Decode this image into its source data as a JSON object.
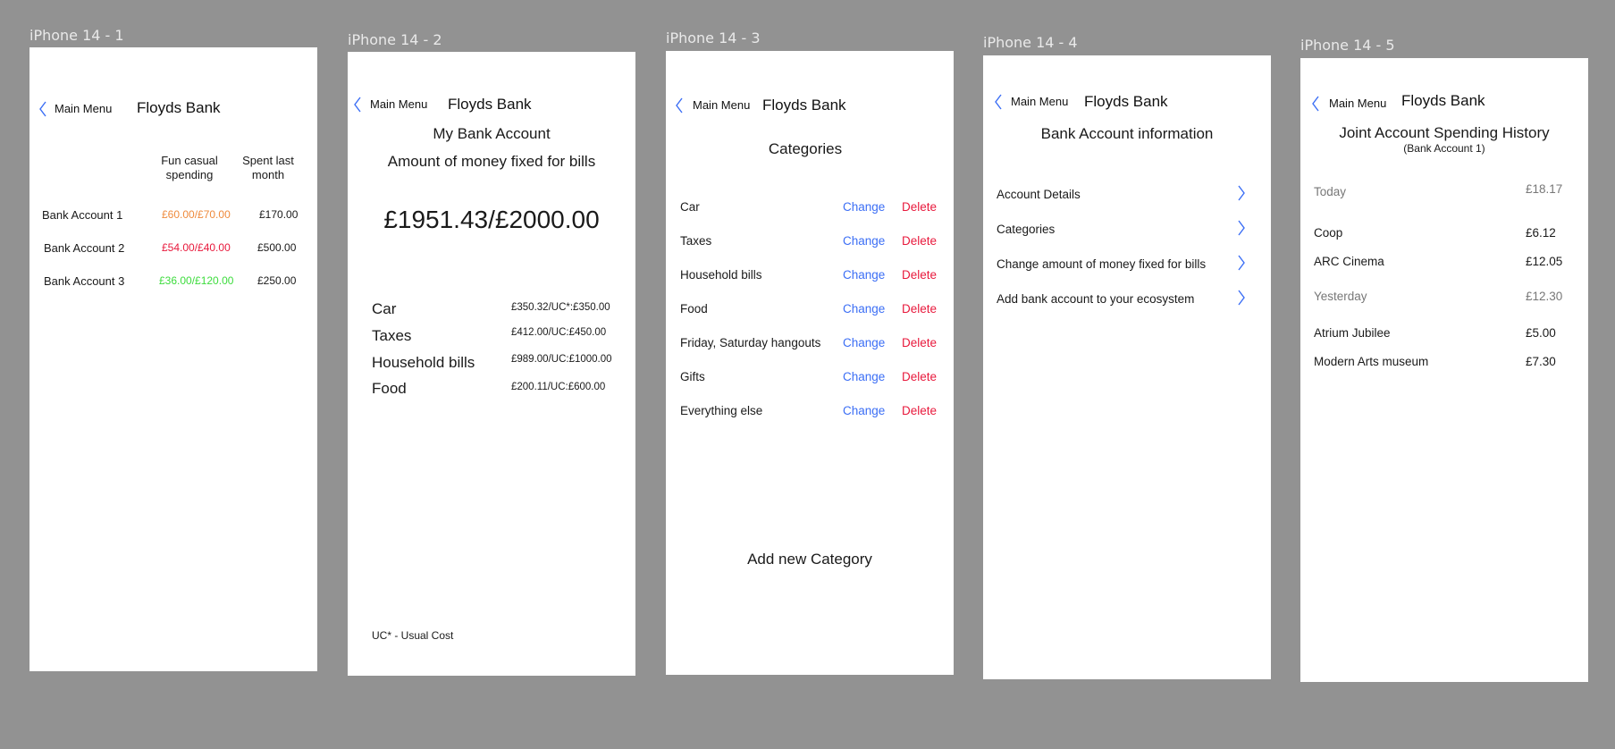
{
  "colors": {
    "background": "#929292",
    "link_blue": "#3b6ef5",
    "delete_red": "#e8193c",
    "amount_orange": "#ef8a3c",
    "amount_red": "#e8193c",
    "amount_green": "#3ddc3d",
    "muted_gray": "#777777"
  },
  "frames": [
    {
      "label": "iPhone 14 - 1",
      "nav": {
        "back": "Main Menu",
        "title": "Floyds Bank"
      },
      "headers": {
        "col1": "Fun casual spending",
        "col2": "Spent last month"
      },
      "rows": [
        {
          "name": "Bank Account 1",
          "fun": "£60.00/£70.00",
          "fun_status": "orange",
          "spent": "£170.00"
        },
        {
          "name": "Bank Account 2",
          "fun": "£54.00/£40.00",
          "fun_status": "red",
          "spent": "£500.00"
        },
        {
          "name": "Bank Account 3",
          "fun": "£36.00/£120.00",
          "fun_status": "green",
          "spent": "£250.00"
        }
      ]
    },
    {
      "label": "iPhone 14 - 2",
      "nav": {
        "back": "Main Menu",
        "title": "Floyds Bank"
      },
      "heading": "My Bank Account",
      "subheading": "Amount of money fixed for bills",
      "total": "£1951.43/£2000.00",
      "bills": [
        {
          "name": "Car",
          "value": "£350.32/UC*:£350.00"
        },
        {
          "name": "Taxes",
          "value": "£412.00/UC:£450.00"
        },
        {
          "name": "Household bills",
          "value": "£989.00/UC:£1000.00"
        },
        {
          "name": "Food",
          "value": "£200.11/UC:£600.00"
        }
      ],
      "footnote": "UC* - Usual Cost"
    },
    {
      "label": "iPhone 14 - 3",
      "nav": {
        "back": "Main Menu",
        "title": "Floyds Bank"
      },
      "heading": "Categories",
      "change_label": "Change",
      "delete_label": "Delete",
      "categories": [
        "Car",
        "Taxes",
        "Household bills",
        "Food",
        "Friday, Saturday hangouts",
        "Gifts",
        "Everything else"
      ],
      "add_label": "Add new Category"
    },
    {
      "label": "iPhone 14 - 4",
      "nav": {
        "back": "Main Menu",
        "title": "Floyds Bank"
      },
      "heading": "Bank Account information",
      "menu": [
        "Account Details",
        "Categories",
        "Change amount of money fixed for bills",
        "Add bank account to your ecosystem"
      ]
    },
    {
      "label": "iPhone 14 - 5",
      "nav": {
        "back": "Main Menu",
        "title": "Floyds Bank"
      },
      "heading": "Joint Account Spending History",
      "subheading": "(Bank Account 1)",
      "groups": [
        {
          "day": "Today",
          "total": "£18.17",
          "items": [
            {
              "name": "Coop",
              "amount": "£6.12"
            },
            {
              "name": "ARC Cinema",
              "amount": "£12.05"
            }
          ]
        },
        {
          "day": "Yesterday",
          "total": "£12.30",
          "items": [
            {
              "name": "Atrium Jubilee",
              "amount": "£5.00"
            },
            {
              "name": "Modern Arts museum",
              "amount": "£7.30"
            }
          ]
        }
      ]
    }
  ]
}
